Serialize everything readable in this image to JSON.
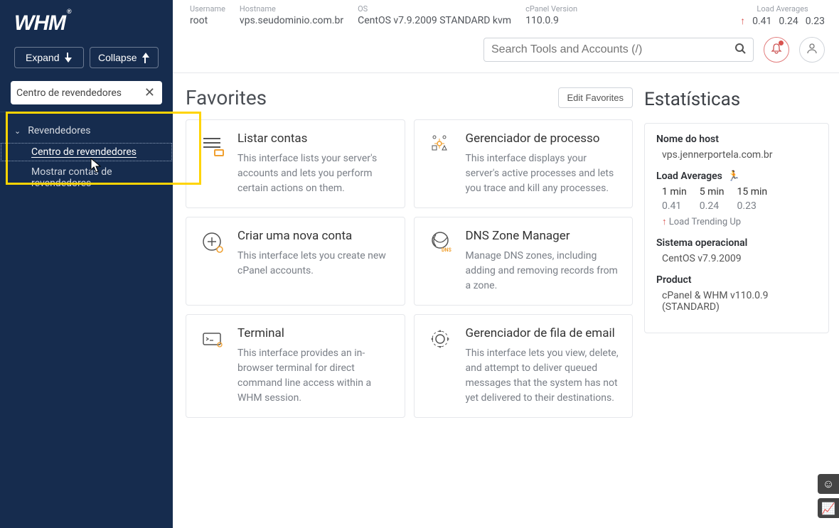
{
  "logo_text": "WHM",
  "sidebar": {
    "expand_label": "Expand",
    "collapse_label": "Collapse",
    "filter_value": "Centro de revendedores",
    "group_label": "Revendedores",
    "items": [
      {
        "label": "Centro de revendedores",
        "active": true
      },
      {
        "label": "Mostrar contas de revendedores",
        "active": false
      }
    ]
  },
  "topbar": {
    "username_label": "Username",
    "username_value": "root",
    "hostname_label": "Hostname",
    "hostname_value": "vps.seudominio.com.br",
    "os_label": "OS",
    "os_value": "CentOS v7.9.2009 STANDARD kvm",
    "cpver_label": "cPanel Version",
    "cpver_value": "110.0.9",
    "la_label": "Load Averages",
    "la_values": [
      "0.41",
      "0.24",
      "0.23"
    ]
  },
  "search": {
    "placeholder": "Search Tools and Accounts (/)"
  },
  "favorites": {
    "title": "Favorites",
    "edit_label": "Edit Favorites",
    "cards": [
      {
        "title": "Listar contas",
        "desc": "This interface lists your server's accounts and lets you perform certain actions on them."
      },
      {
        "title": "Gerenciador de processo",
        "desc": "This interface displays your server's active processes and lets you trace and kill any processes."
      },
      {
        "title": "Criar uma nova conta",
        "desc": "This interface lets you create new cPanel accounts."
      },
      {
        "title": "DNS Zone Manager",
        "desc": "Manage DNS zones, including adding and removing records from a zone."
      },
      {
        "title": "Terminal",
        "desc": "This interface provides an in-browser terminal for direct command line access within a WHM session."
      },
      {
        "title": "Gerenciador de fila de email",
        "desc": "This interface lets you view, delete, and attempt to deliver queued messages that the system has not yet delivered to their destinations."
      }
    ]
  },
  "stats": {
    "title": "Estatísticas",
    "host_label": "Nome do host",
    "host_value": "vps.jennerportela.com.br",
    "la_label": "Load Averages",
    "la_cols": [
      {
        "h": "1 min",
        "v": "0.41"
      },
      {
        "h": "5 min",
        "v": "0.24"
      },
      {
        "h": "15 min",
        "v": "0.23"
      }
    ],
    "trending_label": "Load Trending Up",
    "os_label": "Sistema operacional",
    "os_value": "CentOS v7.9.2009",
    "product_label": "Product",
    "product_value": "cPanel & WHM v110.0.9 (STANDARD)"
  }
}
